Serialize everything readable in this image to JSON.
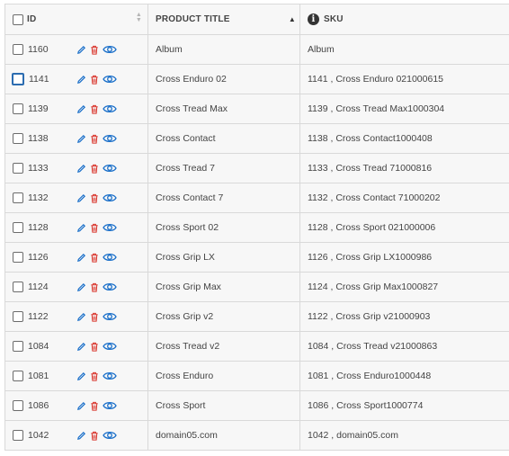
{
  "columns": {
    "id": "ID",
    "title": "PRODUCT TITLE",
    "sku": "SKU"
  },
  "icons": {
    "edit": "pencil-icon",
    "delete": "trash-icon",
    "view": "eye-icon",
    "info": "info-icon",
    "edit_color": "#1a6fc9",
    "delete_color": "#d9342b",
    "view_color": "#1a6fc9"
  },
  "rows": [
    {
      "id": "1160",
      "title": "Album",
      "sku": "Album"
    },
    {
      "id": "1141",
      "title": "Cross Enduro 02",
      "sku": "1141 , Cross Enduro 021000615"
    },
    {
      "id": "1139",
      "title": "Cross Tread Max",
      "sku": "1139 , Cross Tread Max1000304"
    },
    {
      "id": "1138",
      "title": "Cross Contact",
      "sku": "1138 , Cross Contact1000408"
    },
    {
      "id": "1133",
      "title": "Cross Tread 7",
      "sku": "1133 , Cross Tread 71000816"
    },
    {
      "id": "1132",
      "title": "Cross Contact 7",
      "sku": "1132 , Cross Contact 71000202"
    },
    {
      "id": "1128",
      "title": "Cross Sport 02",
      "sku": "1128 , Cross Sport 021000006"
    },
    {
      "id": "1126",
      "title": "Cross Grip LX",
      "sku": "1126 , Cross Grip LX1000986"
    },
    {
      "id": "1124",
      "title": "Cross Grip Max",
      "sku": "1124 , Cross Grip Max1000827"
    },
    {
      "id": "1122",
      "title": "Cross Grip v2",
      "sku": "1122 , Cross Grip v21000903"
    },
    {
      "id": "1084",
      "title": "Cross Tread v2",
      "sku": "1084 , Cross Tread v21000863"
    },
    {
      "id": "1081",
      "title": "Cross Enduro",
      "sku": "1081 , Cross Enduro1000448"
    },
    {
      "id": "1086",
      "title": "Cross Sport",
      "sku": "1086 , Cross Sport1000774"
    },
    {
      "id": "1042",
      "title": "domain05.com",
      "sku": "1042 , domain05.com"
    }
  ]
}
